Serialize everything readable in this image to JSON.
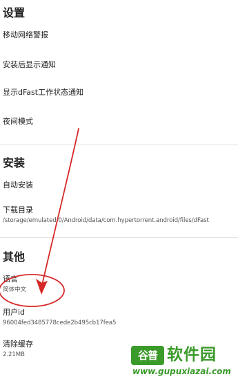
{
  "settings": {
    "title": "设置",
    "items": [
      {
        "title": "移动网络警报"
      },
      {
        "title": "安装后显示通知"
      },
      {
        "title": "显示dFast工作状态通知"
      },
      {
        "title": "夜间模式"
      }
    ]
  },
  "install": {
    "title": "安装",
    "items": [
      {
        "title": "自动安装"
      },
      {
        "title": "下载目录",
        "subtitle": "/storage/emulated/0/Android/data/com.hypertorrent.android/files/dFast"
      }
    ]
  },
  "other": {
    "title": "其他",
    "items": [
      {
        "title": "语言",
        "subtitle": "简体中文"
      },
      {
        "title": "用户id",
        "subtitle": "96004fed3485778cede2b495cb17fea5"
      },
      {
        "title": "清除缓存",
        "subtitle": "2.21MB"
      }
    ]
  },
  "annotation": {
    "color": "#d62828"
  },
  "watermark": {
    "logo_text": "谷普",
    "name": "软件园",
    "url": "www.gupuxiazai.com",
    "color": "#3a9a2a"
  }
}
